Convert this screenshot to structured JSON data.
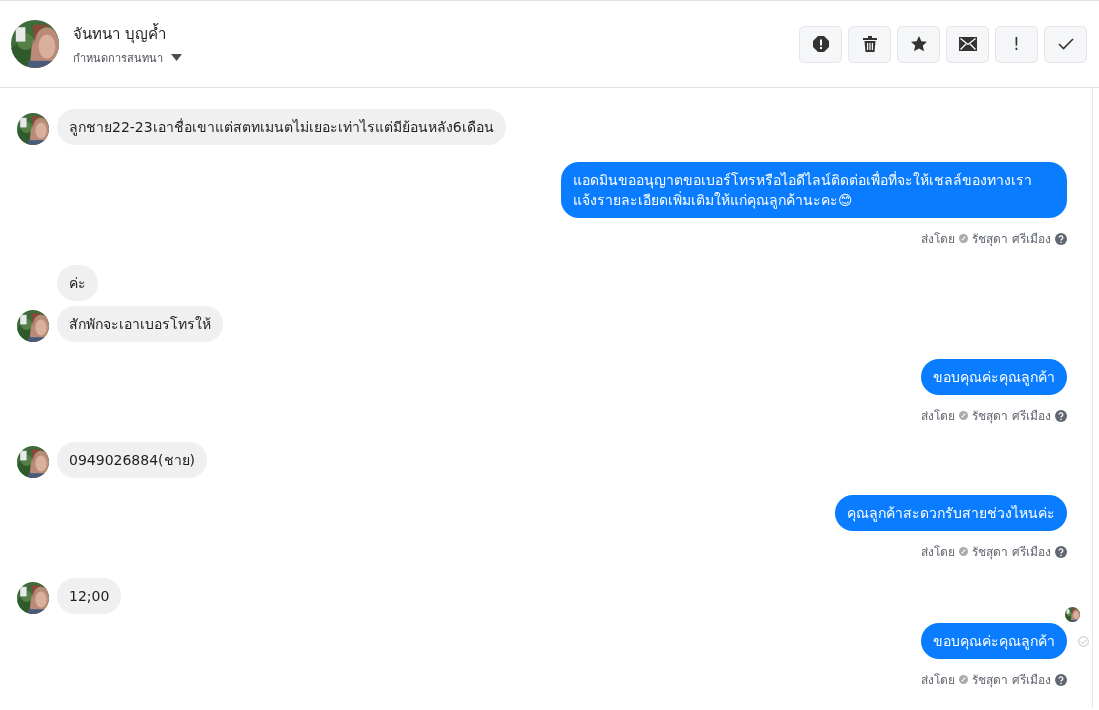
{
  "header": {
    "name": "จันทนา บุญค้ำ",
    "subtitle": "กำหนดการสนทนา",
    "actions": [
      {
        "kind": "alert"
      },
      {
        "kind": "trash"
      },
      {
        "kind": "star"
      },
      {
        "kind": "mail"
      },
      {
        "kind": "text",
        "label": "!"
      },
      {
        "kind": "check"
      }
    ]
  },
  "groups": [
    {
      "kind": "incoming",
      "messages": [
        {
          "text": "ลูกชาย22-23เอาชื่อเขาแต่สตทเมนตไม่เยอะเท่าไรแต่มีย้อนหลัง6เดือน"
        }
      ]
    },
    {
      "kind": "outgoing",
      "messages": [
        {
          "text": "แอดมินขออนุญาตขอเบอร์โทรหรือไอดีไลน์ติดต่อเพื่อที่จะให้เชลล์ของทางเรา แจ้งรายละเอียดเพิ่มเติมให้แก่คุณลูกค้านะคะ😊"
        }
      ],
      "sent_by": "ส่งโดย",
      "agent": "รัชสุดา ศรีเมือง"
    },
    {
      "kind": "incoming",
      "messages": [
        {
          "text": "ค่ะ"
        },
        {
          "text": "สักพักจะเอาเบอรโทรให้"
        }
      ]
    },
    {
      "kind": "outgoing",
      "messages": [
        {
          "text": "ขอบคุณค่ะคุณลูกค้า"
        }
      ],
      "sent_by": "ส่งโดย",
      "agent": "รัชสุดา ศรีเมือง"
    },
    {
      "kind": "incoming",
      "messages": [
        {
          "text": "0949026884(ชาย)"
        }
      ]
    },
    {
      "kind": "outgoing",
      "messages": [
        {
          "text": "คุณลูกค้าสะดวกรับสายช่วงไหนค่ะ"
        }
      ],
      "sent_by": "ส่งโดย",
      "agent": "รัชสุดา ศรีเมือง"
    },
    {
      "kind": "incoming",
      "messages": [
        {
          "text": "12;00"
        }
      ],
      "seen_marker": true
    },
    {
      "kind": "outgoing",
      "messages": [
        {
          "text": "ขอบคุณค่ะคุณลูกค้า",
          "delivered": true
        }
      ],
      "sent_by": "ส่งโดย",
      "agent": "รัชสุดา ศรีเมือง"
    }
  ]
}
